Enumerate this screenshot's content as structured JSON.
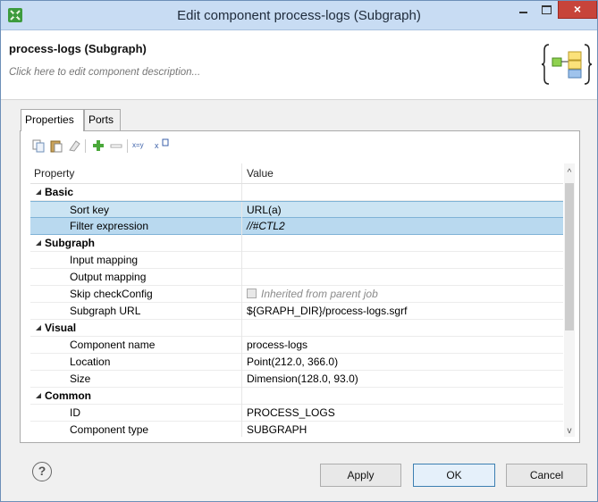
{
  "window": {
    "title": "Edit component process-logs (Subgraph)",
    "close_glyph": "×"
  },
  "header": {
    "component_title": "process-logs (Subgraph)",
    "description_placeholder": "Click here to edit component description..."
  },
  "tabs": [
    {
      "label": "Properties"
    },
    {
      "label": "Ports"
    }
  ],
  "table": {
    "columns": {
      "property": "Property",
      "value": "Value"
    },
    "rows": [
      {
        "name": "Basic",
        "value": ""
      },
      {
        "name": "Sort key",
        "value": "URL(a)"
      },
      {
        "name": "Filter expression",
        "value": "//#CTL2"
      },
      {
        "name": "Subgraph",
        "value": ""
      },
      {
        "name": "Input mapping",
        "value": ""
      },
      {
        "name": "Output mapping",
        "value": ""
      },
      {
        "name": "Skip checkConfig",
        "value": "Inherited from parent job"
      },
      {
        "name": "Subgraph URL",
        "value": "${GRAPH_DIR}/process-logs.sgrf"
      },
      {
        "name": "Visual",
        "value": ""
      },
      {
        "name": "Component name",
        "value": "process-logs"
      },
      {
        "name": "Location",
        "value": "Point(212.0, 366.0)"
      },
      {
        "name": "Size",
        "value": "Dimension(128.0, 93.0)"
      },
      {
        "name": "Common",
        "value": ""
      },
      {
        "name": "ID",
        "value": "PROCESS_LOGS"
      },
      {
        "name": "Component type",
        "value": "SUBGRAPH"
      }
    ]
  },
  "toolbar": {
    "xy_label": "x=y",
    "xedit_label": "x"
  },
  "buttons": {
    "help": "?",
    "apply": "Apply",
    "ok": "OK",
    "cancel": "Cancel"
  },
  "scroll": {
    "up": "^",
    "down": "v"
  }
}
